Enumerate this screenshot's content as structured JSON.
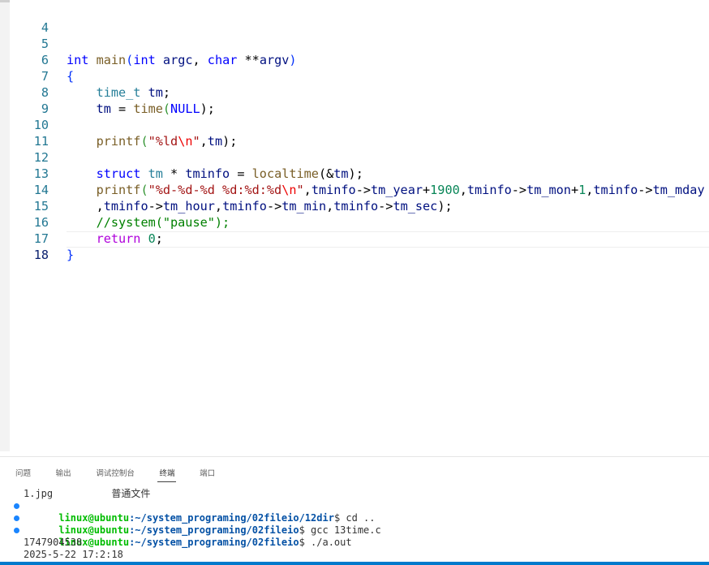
{
  "editor": {
    "active_line": "18",
    "lines": [
      {
        "n": "4"
      },
      {
        "n": "5",
        "t": [
          "int",
          "main",
          "(",
          "int",
          "argc",
          ", ",
          "char",
          " **",
          "argv",
          ")"
        ]
      },
      {
        "n": "6",
        "t": [
          "{"
        ]
      },
      {
        "n": "7",
        "t": [
          "time_t",
          " ",
          "tm",
          ";"
        ]
      },
      {
        "n": "8",
        "t": [
          "tm",
          " = ",
          "time",
          "(",
          "NULL",
          ");"
        ]
      },
      {
        "n": "9"
      },
      {
        "n": "10",
        "t": [
          "printf",
          "(",
          "\"%ld",
          "\\n",
          "\"",
          ",",
          "tm",
          ");"
        ]
      },
      {
        "n": "11"
      },
      {
        "n": "12",
        "t": [
          "struct",
          " ",
          "tm",
          " * ",
          "tminfo",
          " = ",
          "localtime",
          "(&",
          "tm",
          ");"
        ]
      },
      {
        "n": "13",
        "t": [
          "printf",
          "(",
          "\"%d-%d-%d %d:%d:%d",
          "\\n",
          "\"",
          ",",
          "tminfo",
          "->",
          "tm_year",
          "+",
          "1900",
          ",",
          "tminfo",
          "->",
          "tm_mon",
          "+",
          "1",
          ",",
          "tminfo",
          "->",
          "tm_mday"
        ]
      },
      {
        "n": "14",
        "t": [
          ",",
          "tminfo",
          "->",
          "tm_hour",
          ",",
          "tminfo",
          "->",
          "tm_min",
          ",",
          "tminfo",
          "->",
          "tm_sec",
          ");"
        ]
      },
      {
        "n": "15",
        "t": [
          "//system(\"pause\");"
        ]
      },
      {
        "n": "16",
        "t": [
          "return",
          " ",
          "0",
          ";"
        ]
      },
      {
        "n": "17",
        "t": [
          "}"
        ]
      },
      {
        "n": "18"
      }
    ]
  },
  "panel": {
    "tabs": [
      "问题",
      "输出",
      "调试控制台",
      "终端",
      "端口"
    ],
    "active_tab": "终端"
  },
  "terminal": {
    "file_line": "1.jpg          普通文件",
    "entries": [
      {
        "user": "linux@ubuntu",
        "path": ":~/system_programing/02fileio/12dir",
        "cmd": "$ cd .."
      },
      {
        "user": "linux@ubuntu",
        "path": ":~/system_programing/02fileio",
        "cmd": "$ gcc 13time.c"
      },
      {
        "user": "linux@ubuntu",
        "path": ":~/system_programing/02fileio",
        "cmd": "$ ./a.out"
      }
    ],
    "output": [
      "1747904538",
      "2025-5-22 17:2:18"
    ]
  },
  "colors": {
    "keyword": "#0000ff",
    "control": "#af00db",
    "function": "#795e26",
    "type": "#267f99",
    "variable": "#001080",
    "string": "#a31515",
    "escape": "#ee0000",
    "number": "#098658",
    "comment": "#008000",
    "line_number": "#237893",
    "prompt_user": "#00bc00",
    "prompt_path": "#0451a5",
    "status_bar": "#007acc"
  }
}
